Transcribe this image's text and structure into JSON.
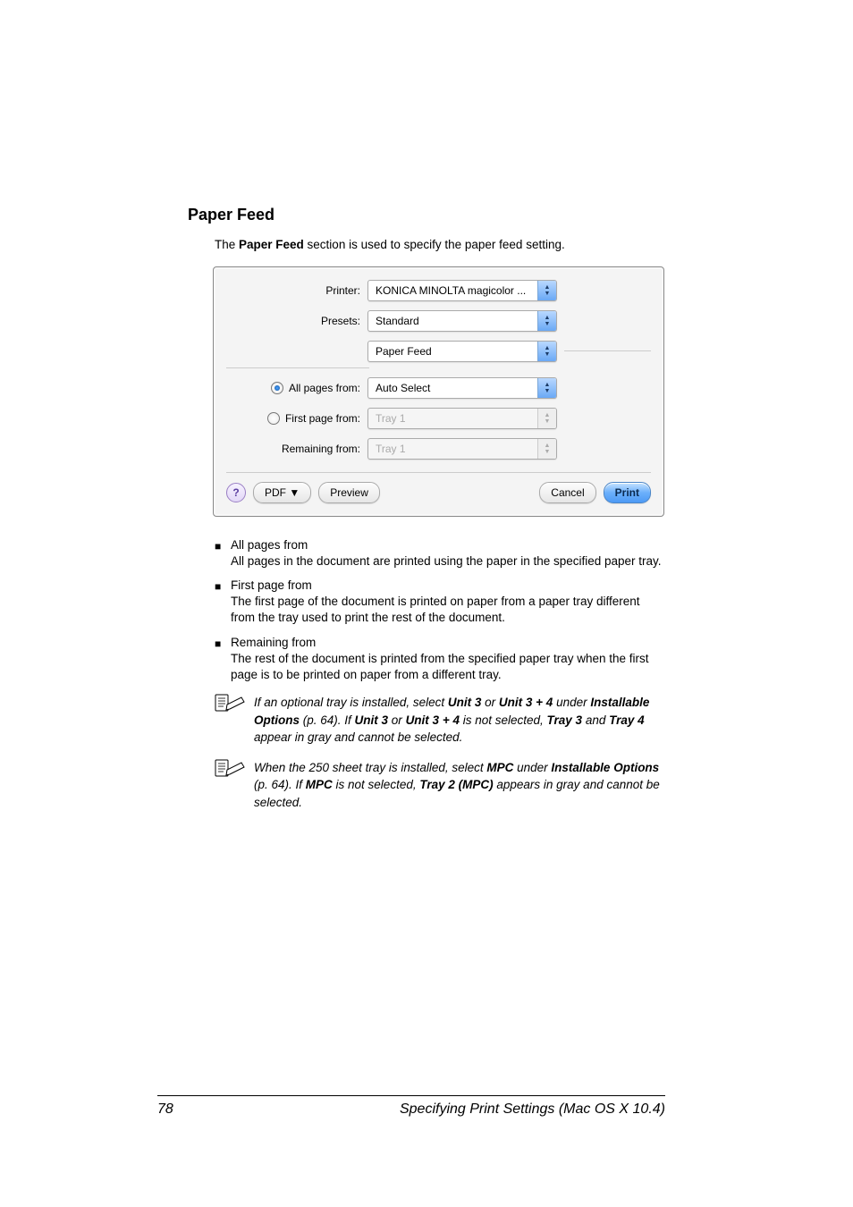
{
  "heading": "Paper Feed",
  "intro_pre": "The ",
  "intro_bold": "Paper Feed",
  "intro_post": " section is used to specify the paper feed setting.",
  "dialog": {
    "printer_label": "Printer:",
    "printer_value": "KONICA MINOLTA magicolor ...",
    "presets_label": "Presets:",
    "presets_value": "Standard",
    "section_value": "Paper Feed",
    "all_label": "All pages from:",
    "all_value": "Auto Select",
    "first_label": "First page from:",
    "first_value": "Tray 1",
    "remaining_label": "Remaining from:",
    "remaining_value": "Tray 1",
    "help": "?",
    "pdf": "PDF ▼",
    "preview": "Preview",
    "cancel": "Cancel",
    "print": "Print"
  },
  "bullets": [
    {
      "title": "All pages from",
      "body": "All pages in the document are printed using the paper in the specified paper tray."
    },
    {
      "title": "First page from",
      "body": "The first page of the document is printed on paper from a paper tray different from the tray used to print the rest of the document."
    },
    {
      "title": "Remaining from",
      "body": "The rest of the document is printed from the specified paper tray when the first page is to be printed on paper from a different tray."
    }
  ],
  "note1": {
    "t1": "If an optional tray is installed, select ",
    "b1": "Unit 3",
    "t2": " or ",
    "b2": "Unit 3 + 4",
    "t3": " under ",
    "b3": "Installable Options",
    "t4": " (p. 64). If ",
    "b4": "Unit 3",
    "t5": " or ",
    "b5": "Unit 3 + 4",
    "t6": " is not selected, ",
    "b6": "Tray 3",
    "t7": " and ",
    "b7": "Tray 4",
    "t8": " appear in gray and cannot be selected."
  },
  "note2": {
    "t1": "When the 250 sheet tray is installed, select ",
    "b1": "MPC",
    "t2": " under ",
    "b2": "Installable Options",
    "t3": " (p. 64). If ",
    "b3": "MPC",
    "t4": " is not selected, ",
    "b4": "Tray 2 (MPC)",
    "t5": " appears in gray and cannot be selected."
  },
  "footer": {
    "page": "78",
    "title": "Specifying Print Settings (Mac OS X 10.4)"
  }
}
